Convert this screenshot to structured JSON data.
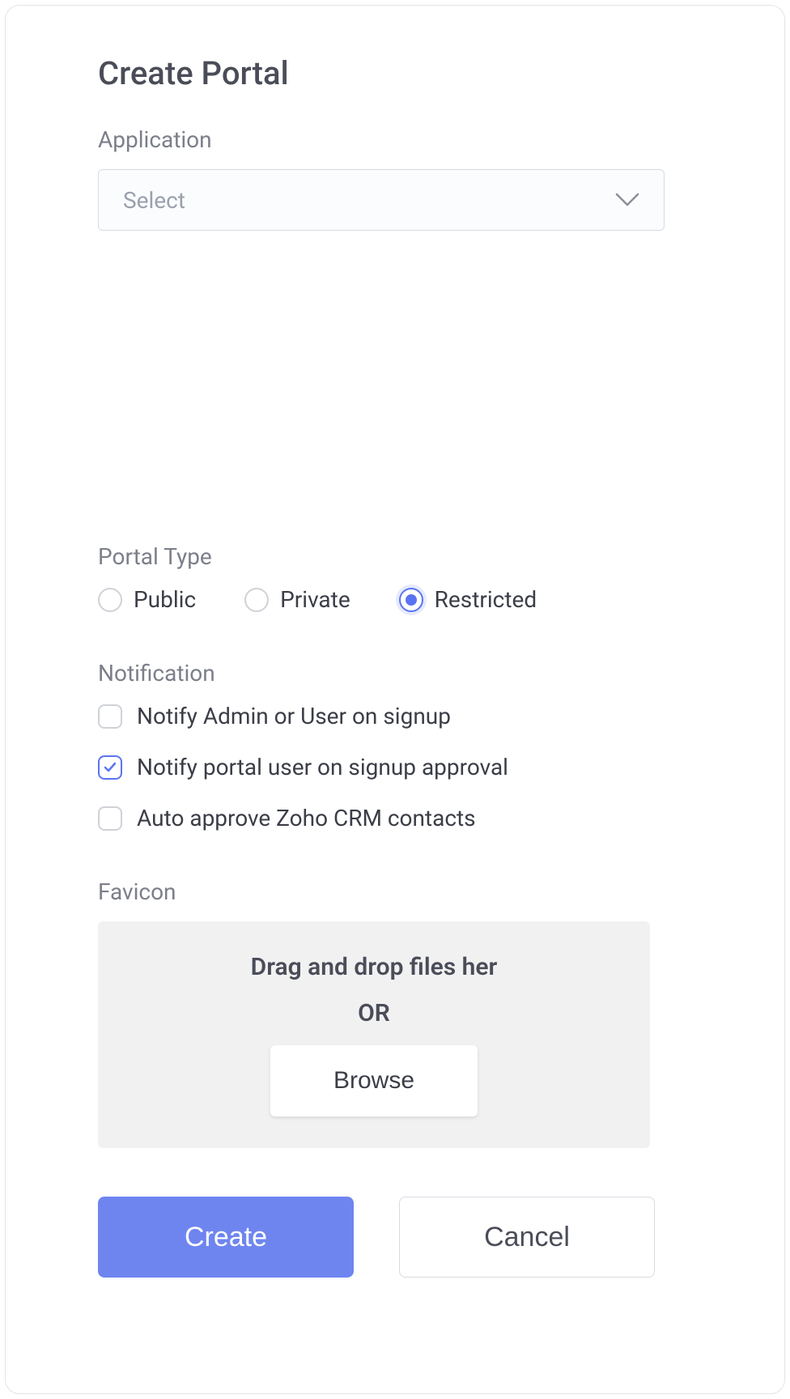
{
  "title": "Create Portal",
  "application": {
    "label": "Application",
    "placeholder": "Select"
  },
  "portalType": {
    "label": "Portal Type",
    "options": [
      {
        "label": "Public",
        "selected": false
      },
      {
        "label": "Private",
        "selected": false
      },
      {
        "label": "Restricted",
        "selected": true
      }
    ]
  },
  "notification": {
    "label": "Notification",
    "options": [
      {
        "label": "Notify Admin or User on signup",
        "checked": false
      },
      {
        "label": "Notify portal user on signup approval",
        "checked": true
      },
      {
        "label": "Auto approve Zoho CRM contacts",
        "checked": false
      }
    ]
  },
  "favicon": {
    "label": "Favicon",
    "dropText": "Drag and drop files her",
    "orText": "OR",
    "browseLabel": "Browse"
  },
  "actions": {
    "create": "Create",
    "cancel": "Cancel"
  }
}
